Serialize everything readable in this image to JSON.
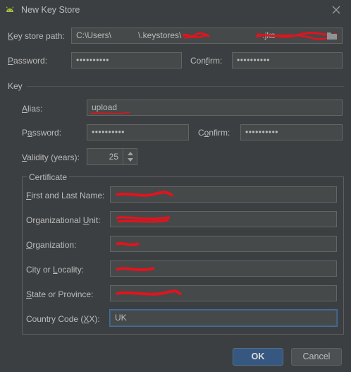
{
  "window": {
    "title": "New Key Store"
  },
  "keystore": {
    "path_label_pre": "K",
    "path_label_post": "ey store path:",
    "path_value_start": "C:\\Users\\",
    "path_value_mid": "\\.keystores\\",
    "path_value_end": ".jks",
    "password_label_pre": "P",
    "password_label_post": "assword:",
    "password_value": "••••••••••",
    "confirm_label_pre": "Con",
    "confirm_label_mid": "f",
    "confirm_label_post": "irm:",
    "confirm_value": "••••••••••"
  },
  "key": {
    "section_label": "Key",
    "alias_label_pre": "A",
    "alias_label_post": "lias:",
    "alias_value": "upload",
    "password_label_pre": "P",
    "password_label_mid": "a",
    "password_label_post": "ssword:",
    "password_value": "••••••••••",
    "confirm_label_pre": "C",
    "confirm_label_mid": "o",
    "confirm_label_post": "nfirm:",
    "confirm_value": "••••••••••",
    "validity_label_pre": "V",
    "validity_label_post": "alidity (years):",
    "validity_value": "25"
  },
  "certificate": {
    "group_label": "Certificate",
    "first_last_pre": "F",
    "first_last_post": "irst and Last Name:",
    "org_unit_pre": "Organizational ",
    "org_unit_mid": "U",
    "org_unit_post": "nit:",
    "organization_pre": "O",
    "organization_post": "rganization:",
    "city_pre": "City or ",
    "city_mid": "L",
    "city_post": "ocality:",
    "state_pre": "S",
    "state_post": "tate or Province:",
    "country_pre": "Country Code (",
    "country_mid": "X",
    "country_post": "X):",
    "country_value": "UK"
  },
  "buttons": {
    "ok": "OK",
    "cancel": "Cancel"
  },
  "colors": {
    "background": "#3c3f41",
    "field_bg": "#45494a",
    "text": "#bbbbbb",
    "primary": "#365880",
    "redaction": "#e0141e",
    "android": "#a4c639"
  }
}
